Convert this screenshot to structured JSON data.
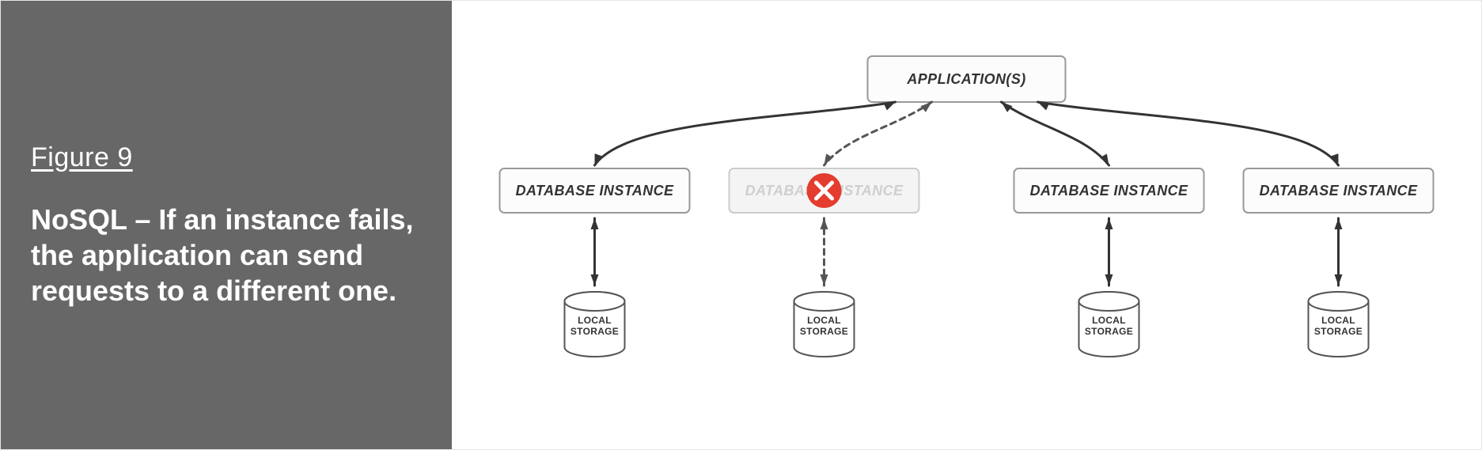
{
  "figure_label": "Figure 9",
  "caption": "NoSQL – If an instance fails, the application can send requests to a different one.",
  "diagram": {
    "root": "APPLICATION(S)",
    "instances": [
      {
        "label": "DATABASE INSTANCE",
        "failed": false
      },
      {
        "label": "DATABASE INSTANCE",
        "failed": true
      },
      {
        "label": "DATABASE INSTANCE",
        "failed": false
      },
      {
        "label": "DATABASE INSTANCE",
        "failed": false
      }
    ],
    "storage_label_line1": "LOCAL",
    "storage_label_line2": "STORAGE"
  }
}
